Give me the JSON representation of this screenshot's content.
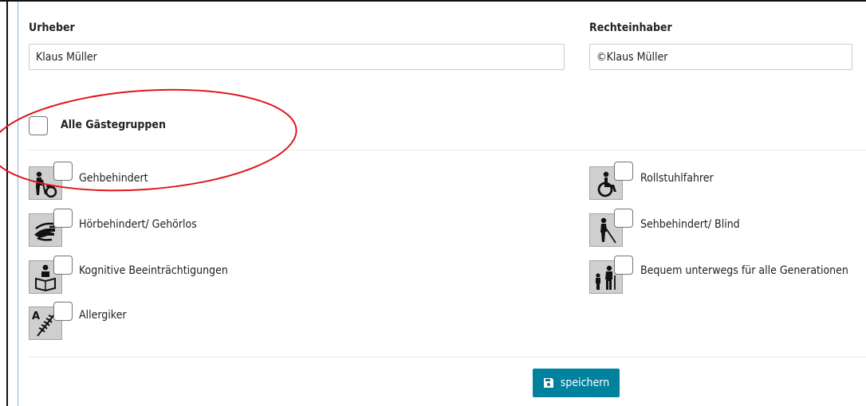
{
  "fields": {
    "author_label": "Urheber",
    "author_value": "Klaus Müller",
    "rights_holder_label": "Rechteinhaber",
    "rights_holder_value": "©Klaus Müller"
  },
  "all_groups_label": "Alle Gästegruppen",
  "guest_groups": [
    {
      "label": "Gehbehindert",
      "icon": "walking-impaired-icon",
      "checked": false
    },
    {
      "label": "Rollstuhlfahrer",
      "icon": "wheelchair-icon",
      "checked": false
    },
    {
      "label": "Hörbehindert/ Gehörlos",
      "icon": "sign-language-icon",
      "checked": false
    },
    {
      "label": "Sehbehindert/ Blind",
      "icon": "blind-cane-icon",
      "checked": false
    },
    {
      "label": "Kognitive Beeinträchtigungen",
      "icon": "cognitive-reading-icon",
      "checked": false
    },
    {
      "label": "Bequem unterwegs für alle Generationen",
      "icon": "generations-icon",
      "checked": false
    },
    {
      "label": "Allergiker",
      "icon": "allergy-wheat-icon",
      "checked": false
    }
  ],
  "save_label": "speichern",
  "colors": {
    "button": "#00829e",
    "annotation": "#e0161c",
    "frame_accent": "#7fb4d6"
  }
}
